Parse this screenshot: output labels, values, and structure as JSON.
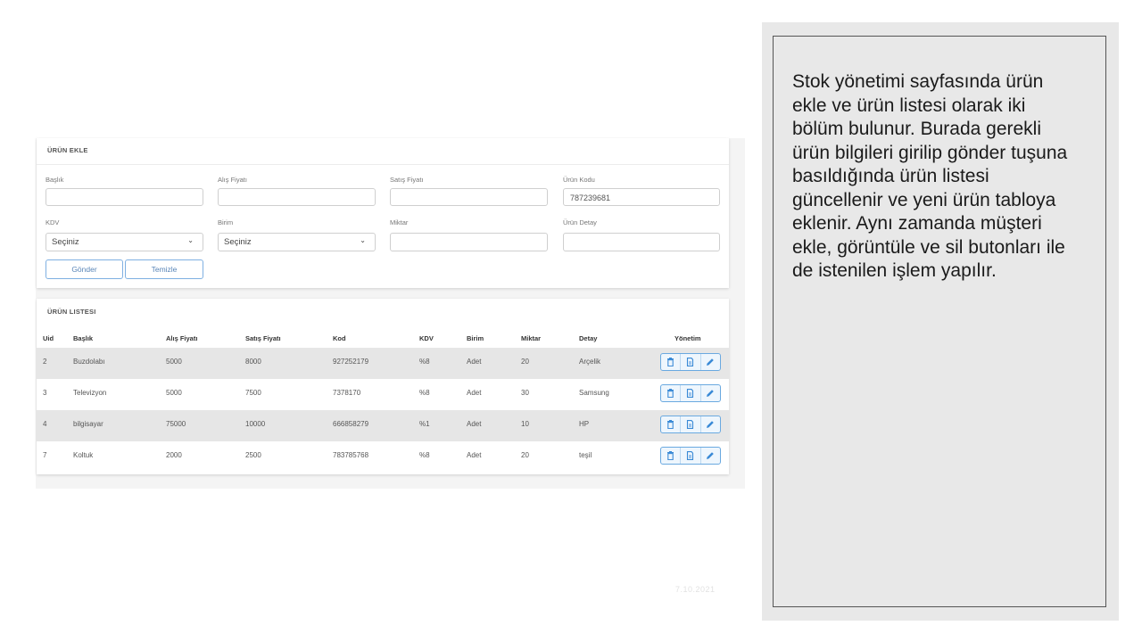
{
  "form": {
    "title": "ÜRÜN EKLE",
    "fields": {
      "baslik": {
        "label": "Başlık",
        "value": ""
      },
      "alis_fiyati": {
        "label": "Alış Fiyatı",
        "value": ""
      },
      "satis_fiyati": {
        "label": "Satış Fiyatı",
        "value": ""
      },
      "urun_kodu": {
        "label": "Ürün Kodu",
        "value": "787239681"
      },
      "kdv": {
        "label": "KDV",
        "value": "Seçiniz"
      },
      "birim": {
        "label": "Birim",
        "value": "Seçiniz"
      },
      "miktar": {
        "label": "Miktar",
        "value": ""
      },
      "urun_detay": {
        "label": "Ürün Detay",
        "value": ""
      }
    },
    "submit_label": "Gönder",
    "clear_label": "Temizle"
  },
  "list": {
    "title": "ÜRÜN LISTESI",
    "columns": [
      "Uid",
      "Başlık",
      "Alış Fiyatı",
      "Satış Fiyatı",
      "Kod",
      "KDV",
      "Birim",
      "Miktar",
      "Detay",
      "Yönetim"
    ],
    "rows": [
      {
        "uid": "2",
        "baslik": "Buzdolabı",
        "alis": "5000",
        "satis": "8000",
        "kod": "927252179",
        "kdv": "%8",
        "birim": "Adet",
        "miktar": "20",
        "detay": "Arçelik"
      },
      {
        "uid": "3",
        "baslik": "Televizyon",
        "alis": "5000",
        "satis": "7500",
        "kod": "7378170",
        "kdv": "%8",
        "birim": "Adet",
        "miktar": "30",
        "detay": "Samsung"
      },
      {
        "uid": "4",
        "baslik": "bilgisayar",
        "alis": "75000",
        "satis": "10000",
        "kod": "666858279",
        "kdv": "%1",
        "birim": "Adet",
        "miktar": "10",
        "detay": "HP"
      },
      {
        "uid": "7",
        "baslik": "Koltuk",
        "alis": "2000",
        "satis": "2500",
        "kod": "783785768",
        "kdv": "%8",
        "birim": "Adet",
        "miktar": "20",
        "detay": "teşil"
      }
    ],
    "actions": {
      "delete_icon": "trash-icon",
      "view_icon": "document-icon",
      "edit_icon": "pencil-icon"
    }
  },
  "slide_date": "7.10.2021",
  "description": "Stok yönetimi sayfasında ürün ekle ve ürün listesi olarak iki bölüm bulunur. Burada gerekli ürün bilgileri girilip gönder tuşuna basıldığında ürün listesi güncellenir ve yeni ürün tabloya eklenir. Aynı zamanda müşteri ekle, görüntüle ve sil butonları ile de istenilen işlem yapılır.",
  "colors": {
    "accent": "#6aa9e0",
    "row_alt": "#e6e6e6",
    "panel_bg": "#e8e8e8"
  }
}
